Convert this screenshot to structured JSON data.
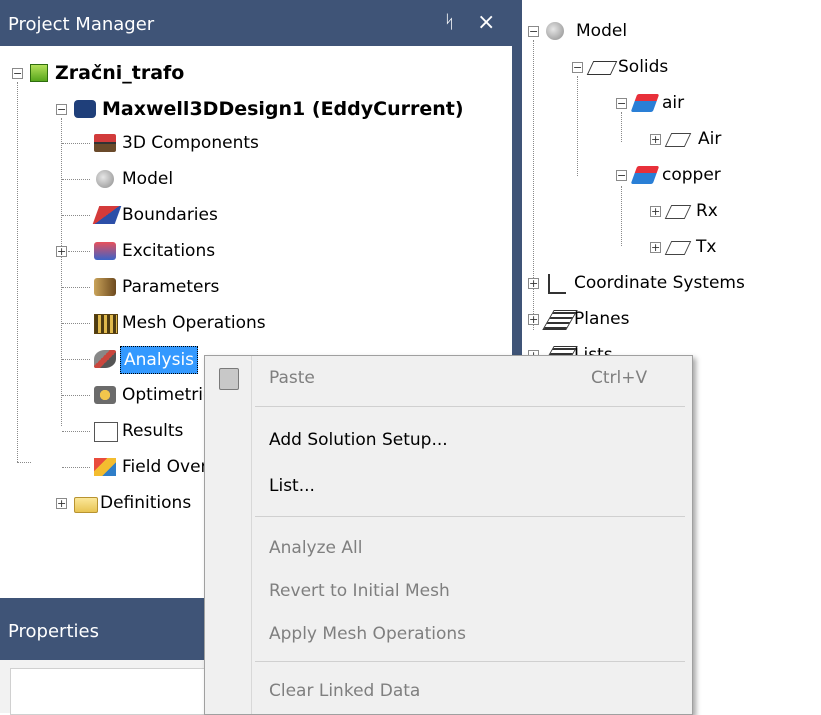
{
  "project_manager": {
    "title": "Project Manager",
    "pin_glyph": "ᛋ",
    "close_glyph": "×",
    "tree": {
      "project": "Zračni_trafo",
      "design": "Maxwell3DDesign1 (EddyCurrent)",
      "items": [
        {
          "label": "3D Components",
          "icon": "3d-components-icon"
        },
        {
          "label": "Model",
          "icon": "model-icon"
        },
        {
          "label": "Boundaries",
          "icon": "boundaries-icon"
        },
        {
          "label": "Excitations",
          "icon": "excitations-icon"
        },
        {
          "label": "Parameters",
          "icon": "parameters-icon"
        },
        {
          "label": "Mesh Operations",
          "icon": "mesh-operations-icon"
        },
        {
          "label": "Analysis",
          "icon": "analysis-icon"
        },
        {
          "label": "Optimetrics",
          "icon": "optimetrics-icon"
        },
        {
          "label": "Results",
          "icon": "results-icon"
        },
        {
          "label": "Field Overlays",
          "icon": "field-overlays-icon"
        }
      ],
      "definitions": "Definitions"
    }
  },
  "properties": {
    "title": "Properties"
  },
  "model_tree": {
    "model": "Model",
    "solids": "Solids",
    "air_group": "air",
    "air_obj": "Air",
    "copper_group": "copper",
    "rx": "Rx",
    "tx": "Tx",
    "coordinate_systems": "Coordinate Systems",
    "planes": "Planes",
    "lists": "Lists"
  },
  "context_menu": {
    "paste": "Paste",
    "paste_shortcut": "Ctrl+V",
    "add_solution_setup": "Add Solution Setup...",
    "list": "List...",
    "analyze_all": "Analyze All",
    "revert_mesh": "Revert to Initial Mesh",
    "apply_mesh_ops": "Apply Mesh Operations",
    "clear_linked": "Clear Linked Data"
  },
  "colors": {
    "panel_header": "#3f5477",
    "selection": "#3399ff"
  }
}
